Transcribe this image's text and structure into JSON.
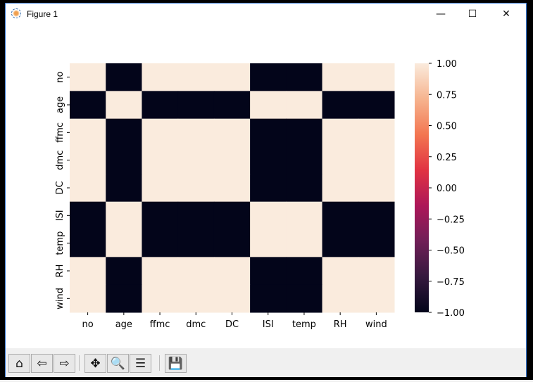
{
  "window": {
    "title": "Figure 1",
    "controls": {
      "minimize": "—",
      "maximize": "☐",
      "close": "✕"
    }
  },
  "toolbar": {
    "buttons": [
      {
        "name": "home",
        "glyph": "⌂"
      },
      {
        "name": "back",
        "glyph": "⇦"
      },
      {
        "name": "forward",
        "glyph": "⇨"
      },
      {
        "name": "pan",
        "glyph": "✥"
      },
      {
        "name": "zoom",
        "glyph": "🔍"
      },
      {
        "name": "configure-subplots",
        "glyph": "☰"
      },
      {
        "name": "save",
        "glyph": "💾"
      }
    ]
  },
  "chart_data": {
    "type": "heatmap",
    "title": "",
    "xlabels": [
      "no",
      "age",
      "ffmc",
      "dmc",
      "DC",
      "ISI",
      "temp",
      "RH",
      "wind"
    ],
    "ylabels": [
      "no",
      "age",
      "ffmc",
      "dmc",
      "DC",
      "ISI",
      "temp",
      "RH",
      "wind"
    ],
    "values": [
      [
        1,
        -1,
        1,
        1,
        1,
        -1,
        -1,
        1,
        1
      ],
      [
        -1,
        1,
        -1,
        -1,
        -1,
        1,
        1,
        -1,
        -1
      ],
      [
        1,
        -1,
        1,
        1,
        1,
        -1,
        -1,
        1,
        1
      ],
      [
        1,
        -1,
        1,
        1,
        1,
        -1,
        -1,
        1,
        1
      ],
      [
        1,
        -1,
        1,
        1,
        1,
        -1,
        -1,
        1,
        1
      ],
      [
        -1,
        1,
        -1,
        -1,
        -1,
        1,
        1,
        -1,
        -1
      ],
      [
        -1,
        1,
        -1,
        -1,
        -1,
        1,
        1,
        -1,
        -1
      ],
      [
        1,
        -1,
        1,
        1,
        1,
        -1,
        -1,
        1,
        1
      ],
      [
        1,
        -1,
        1,
        1,
        1,
        -1,
        -1,
        1,
        1
      ]
    ],
    "colorbar": {
      "range": [
        -1,
        1
      ],
      "ticks": [
        "1.00",
        "0.75",
        "0.50",
        "0.25",
        "0.00",
        "−0.25",
        "−0.50",
        "−0.75",
        "−1.00"
      ],
      "tick_values": [
        1,
        0.75,
        0.5,
        0.25,
        0,
        -0.25,
        -0.5,
        -0.75,
        -1
      ],
      "colormap": [
        "#03051a",
        "#35193e",
        "#701f57",
        "#ad1759",
        "#e13342",
        "#f37651",
        "#f6b48f",
        "#faebdd"
      ]
    }
  }
}
